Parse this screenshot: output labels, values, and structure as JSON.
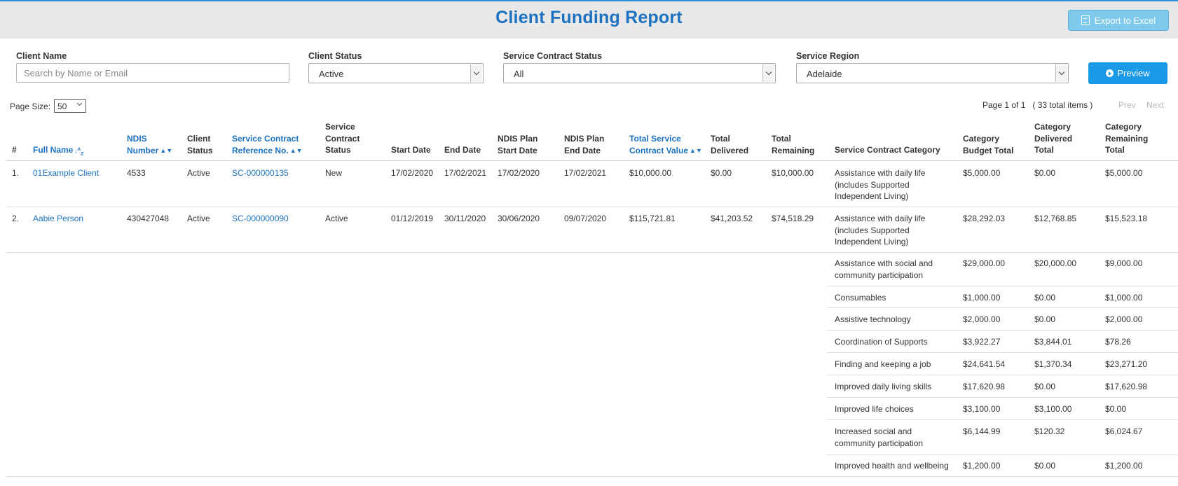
{
  "header": {
    "title": "Client Funding Report",
    "export_label": "Export to Excel"
  },
  "filters": {
    "client_name_label": "Client Name",
    "client_name_placeholder": "Search by Name or Email",
    "client_name_value": "",
    "client_status_label": "Client Status",
    "client_status_value": "Active",
    "contract_status_label": "Service Contract Status",
    "contract_status_value": "All",
    "region_label": "Service Region",
    "region_value": "Adelaide",
    "preview_label": "Preview"
  },
  "paging": {
    "page_size_label": "Page Size:",
    "page_size_value": "50",
    "info": "Page 1 of 1   ( 33 total items )",
    "prev_label": "Prev",
    "next_label": "Next"
  },
  "columns": {
    "num": "#",
    "full_name": "Full Name",
    "ndis_number_1": "NDIS",
    "ndis_number_2": "Number",
    "client_status_1": "Client",
    "client_status_2": "Status",
    "contract_ref_1": "Service Contract",
    "contract_ref_2": "Reference No.",
    "contract_status_1": "Service",
    "contract_status_2": "Contract",
    "contract_status_3": "Status",
    "start_date": "Start Date",
    "end_date": "End Date",
    "plan_start_1": "NDIS Plan",
    "plan_start_2": "Start Date",
    "plan_end_1": "NDIS Plan",
    "plan_end_2": "End Date",
    "total_value_1": "Total Service",
    "total_value_2": "Contract Value",
    "total_delivered_1": "Total",
    "total_delivered_2": "Delivered",
    "total_remaining_1": "Total",
    "total_remaining_2": "Remaining",
    "category": "Service Contract Category",
    "cat_budget_1": "Category",
    "cat_budget_2": "Budget Total",
    "cat_delivered_1": "Category",
    "cat_delivered_2": "Delivered",
    "cat_delivered_3": "Total",
    "cat_remaining_1": "Category",
    "cat_remaining_2": "Remaining",
    "cat_remaining_3": "Total"
  },
  "rows": [
    {
      "num": "1.",
      "name": "01Example Client",
      "ndis": "4533",
      "status": "Active",
      "ref": "SC-000000135",
      "contract_status": "New",
      "start": "17/02/2020",
      "end": "17/02/2021",
      "plan_start": "17/02/2020",
      "plan_end": "17/02/2021",
      "total_value": "$10,000.00",
      "total_delivered": "$0.00",
      "total_remaining": "$10,000.00",
      "categories": [
        {
          "lines": [
            "Assistance with daily life",
            "(includes Supported",
            "Independent Living)"
          ],
          "budget": "$5,000.00",
          "delivered": "$0.00",
          "remaining": "$5,000.00"
        }
      ]
    },
    {
      "num": "2.",
      "name": "Aabie Person",
      "ndis": "430427048",
      "status": "Active",
      "ref": "SC-000000090",
      "contract_status": "Active",
      "start": "01/12/2019",
      "end": "30/11/2020",
      "plan_start": "30/06/2020",
      "plan_end": "09/07/2020",
      "total_value": "$115,721.81",
      "total_delivered": "$41,203.52",
      "total_remaining": "$74,518.29",
      "categories": [
        {
          "lines": [
            "Assistance with daily life",
            "(includes Supported",
            "Independent Living)"
          ],
          "budget": "$28,292.03",
          "delivered": "$12,768.85",
          "remaining": "$15,523.18"
        },
        {
          "lines": [
            "Assistance with social and",
            "community participation"
          ],
          "budget": "$29,000.00",
          "delivered": "$20,000.00",
          "remaining": "$9,000.00"
        },
        {
          "lines": [
            "Consumables"
          ],
          "budget": "$1,000.00",
          "delivered": "$0.00",
          "remaining": "$1,000.00"
        },
        {
          "lines": [
            "Assistive technology"
          ],
          "budget": "$2,000.00",
          "delivered": "$0.00",
          "remaining": "$2,000.00"
        },
        {
          "lines": [
            "Coordination of Supports"
          ],
          "budget": "$3,922.27",
          "delivered": "$3,844.01",
          "remaining": "$78.26"
        },
        {
          "lines": [
            "Finding and keeping a job"
          ],
          "budget": "$24,641.54",
          "delivered": "$1,370.34",
          "remaining": "$23,271.20"
        },
        {
          "lines": [
            "Improved daily living skills"
          ],
          "budget": "$17,620.98",
          "delivered": "$0.00",
          "remaining": "$17,620.98"
        },
        {
          "lines": [
            "Improved life choices"
          ],
          "budget": "$3,100.00",
          "delivered": "$3,100.00",
          "remaining": "$0.00"
        },
        {
          "lines": [
            "Increased social and",
            "community participation"
          ],
          "budget": "$6,144.99",
          "delivered": "$120.32",
          "remaining": "$6,024.67"
        },
        {
          "lines": [
            "Improved health and wellbeing"
          ],
          "budget": "$1,200.00",
          "delivered": "$0.00",
          "remaining": "$1,200.00"
        }
      ]
    }
  ]
}
